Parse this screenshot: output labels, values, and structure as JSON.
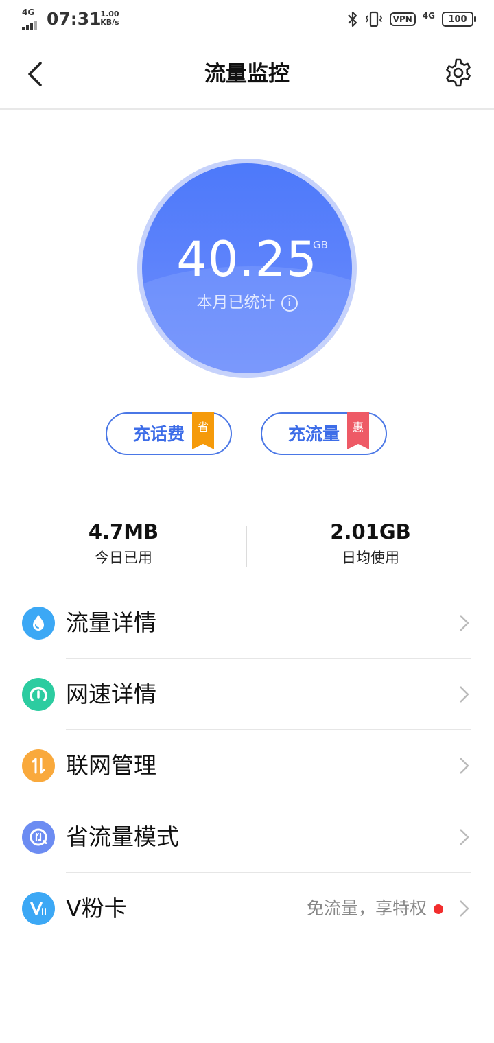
{
  "status_bar": {
    "network_label": "4G",
    "time": "07:31",
    "speed_value": "1.00",
    "speed_unit": "KB/s",
    "vpn_label": "VPN",
    "cell_label": "4G",
    "battery": "100"
  },
  "app_bar": {
    "title": "流量监控",
    "back_icon": "chevron-left-icon",
    "settings_icon": "gear-icon"
  },
  "usage": {
    "value": "40.25",
    "unit": "GB",
    "caption": "本月已统计",
    "info_icon": "i",
    "colors": {
      "disc_top": "#4d79fa",
      "disc_bottom": "#7190fb",
      "ring": "#c6d2fb"
    }
  },
  "actions": [
    {
      "label": "充话费",
      "tag": "省",
      "tag_color": "#f59a0a"
    },
    {
      "label": "充流量",
      "tag": "惠",
      "tag_color": "#ee5a66"
    }
  ],
  "stats": [
    {
      "value": "4.7MB",
      "label": "今日已用"
    },
    {
      "value": "2.01GB",
      "label": "日均使用"
    }
  ],
  "menu": [
    {
      "label": "流量详情",
      "icon": "water-drop-icon",
      "color": "#3ca8f5"
    },
    {
      "label": "网速详情",
      "icon": "speedometer-icon",
      "color": "#2ccca0"
    },
    {
      "label": "联网管理",
      "icon": "transfer-arrows-icon",
      "color": "#f9a93c"
    },
    {
      "label": "省流量模式",
      "icon": "data-saver-icon",
      "color": "#6c8cf2"
    },
    {
      "label": "V粉卡",
      "icon": "v-card-icon",
      "color": "#3ca8f5",
      "aside": "免流量，享特权",
      "badge": "red-dot"
    }
  ]
}
